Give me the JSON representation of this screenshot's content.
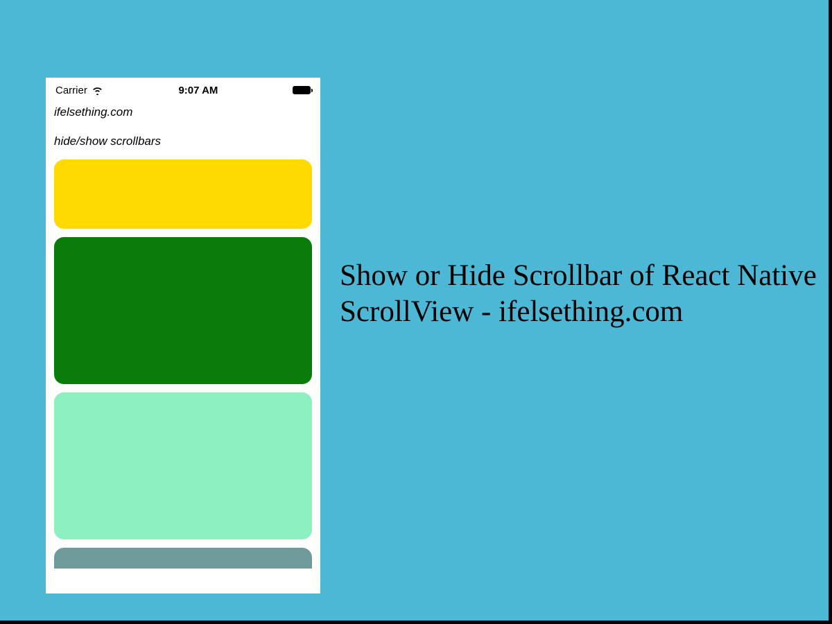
{
  "statusbar": {
    "carrier": "Carrier",
    "time": "9:07 AM"
  },
  "app": {
    "site_label": "ifelsething.com",
    "screen_label": "hide/show scrollbars"
  },
  "blocks": {
    "colors": [
      "#ffd900",
      "#0a7c0a",
      "#8cf0c1",
      "#6f9a9a"
    ]
  },
  "headline": "Show or Hide Scrollbar of React Native ScrollView - ifelsething.com",
  "bg_color": "#4db8d6"
}
